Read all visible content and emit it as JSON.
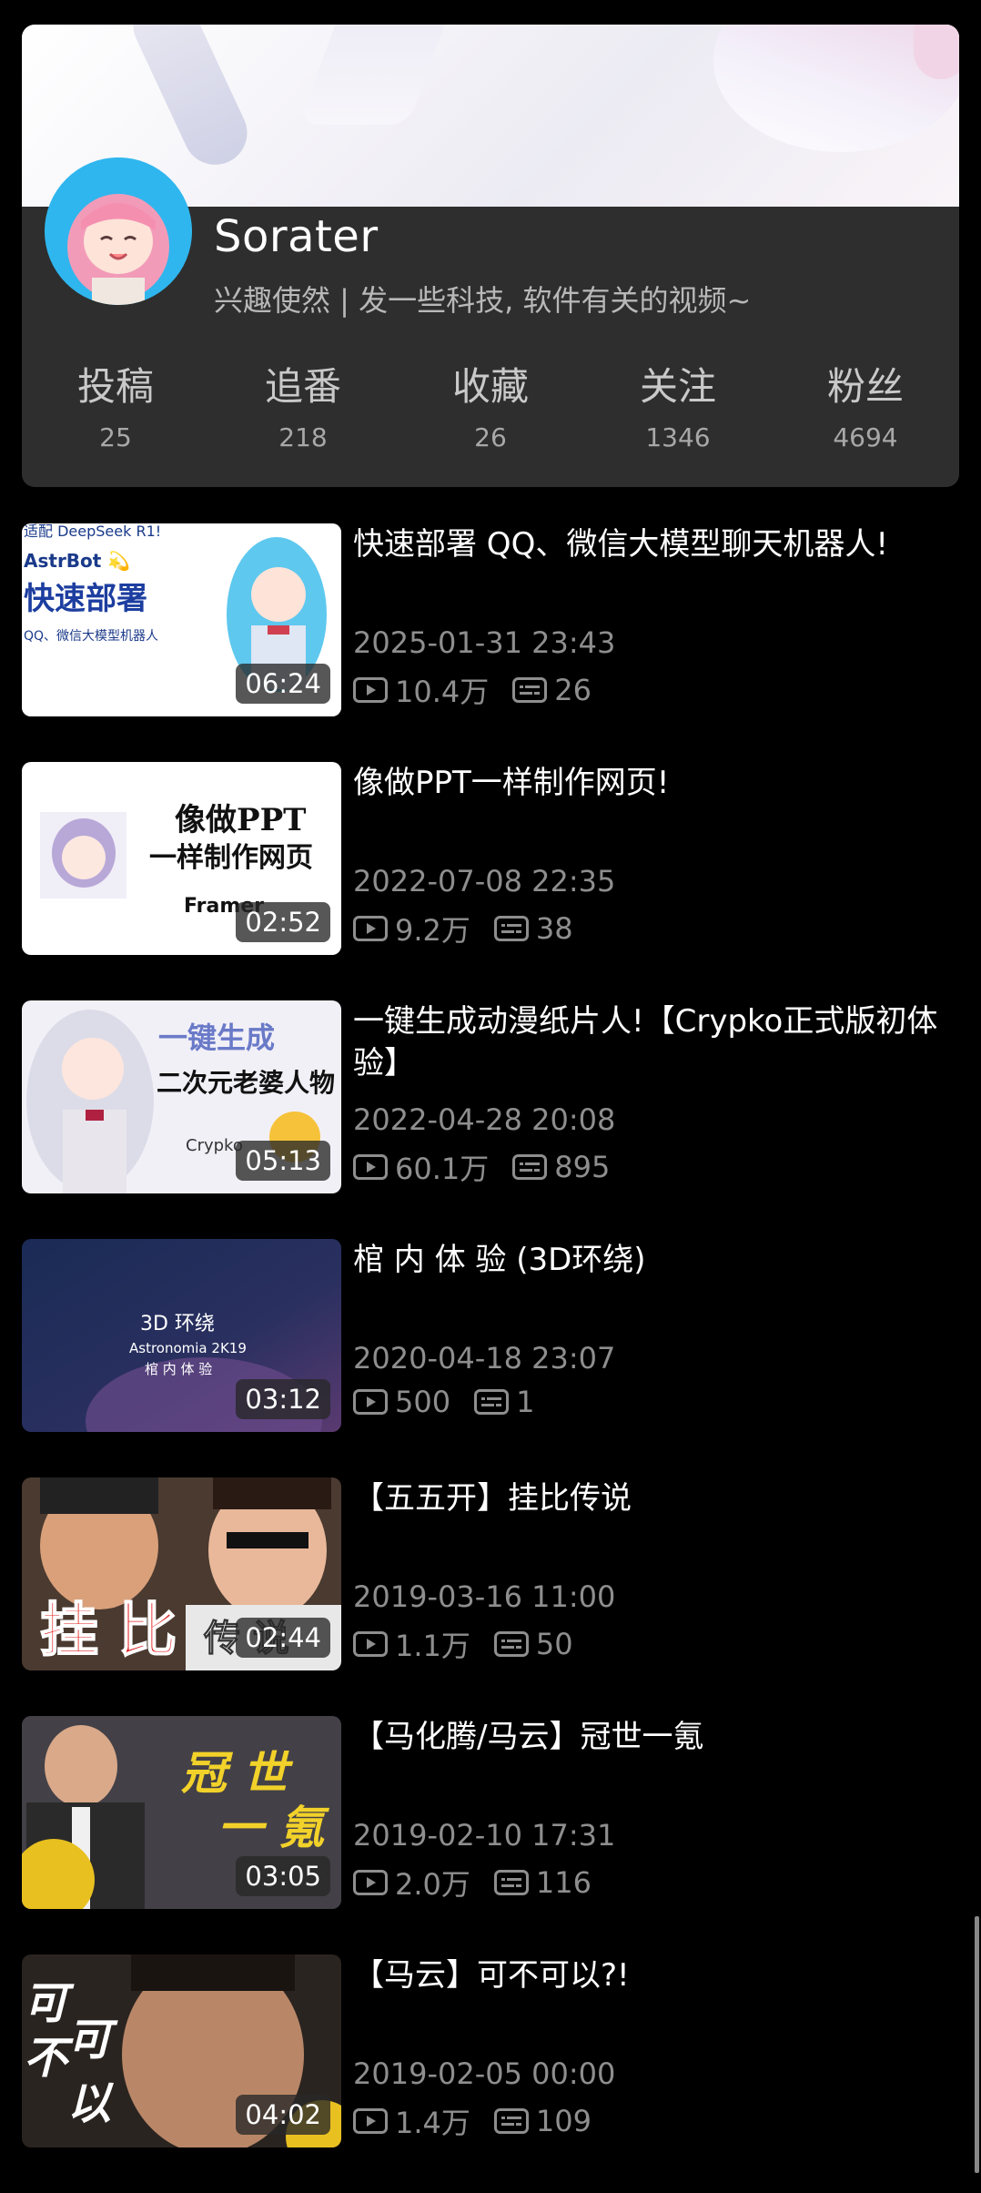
{
  "profile": {
    "name": "Sorater",
    "bio": "兴趣使然 | 发一些科技, 软件有关的视频~",
    "stats": [
      {
        "label": "投稿",
        "value": "25"
      },
      {
        "label": "追番",
        "value": "218"
      },
      {
        "label": "收藏",
        "value": "26"
      },
      {
        "label": "关注",
        "value": "1346"
      },
      {
        "label": "粉丝",
        "value": "4694"
      }
    ]
  },
  "videos": [
    {
      "title": "快速部署 QQ、微信大模型聊天机器人!",
      "date": "2025-01-31 23:43",
      "views": "10.4万",
      "danmaku": "26",
      "duration": "06:24",
      "thumb": {
        "bg": "#ffffff",
        "lines": [
          "适配 DeepSeek R1!",
          "AstrBot 💫",
          "快速部署",
          "QQ、微信大模型机器人"
        ]
      }
    },
    {
      "title": "像做PPT一样制作网页!",
      "date": "2022-07-08 22:35",
      "views": "9.2万",
      "danmaku": "38",
      "duration": "02:52",
      "thumb": {
        "bg": "#ffffff",
        "lines": [
          "像做PPT",
          "一样制作网页",
          "Framer"
        ]
      }
    },
    {
      "title": "一键生成动漫纸片人!【Crypko正式版初体验】",
      "date": "2022-04-28 20:08",
      "views": "60.1万",
      "danmaku": "895",
      "duration": "05:13",
      "thumb": {
        "bg": "#f2f0f7",
        "lines": [
          "一键生成",
          "二次元老婆人物",
          "Crypko"
        ]
      }
    },
    {
      "title": "棺 内 体 验 (3D环绕)",
      "date": "2020-04-18 23:07",
      "views": "500",
      "danmaku": "1",
      "duration": "03:12",
      "thumb": {
        "bg": "#1b2340",
        "lines": [
          "3D 环绕",
          "Astronomia 2K19",
          "棺 内 体 验"
        ]
      }
    },
    {
      "title": "【五五开】挂比传说",
      "date": "2019-03-16 11:00",
      "views": "1.1万",
      "danmaku": "50",
      "duration": "02:44",
      "thumb": {
        "bg": "#4a3a30",
        "lines": [
          "挂 比",
          "传 说"
        ]
      }
    },
    {
      "title": "【马化腾/马云】冠世一氪",
      "date": "2019-02-10 17:31",
      "views": "2.0万",
      "danmaku": "116",
      "duration": "03:05",
      "thumb": {
        "bg": "#3a3a3a",
        "lines": [
          "冠 世",
          "一 氪"
        ]
      }
    },
    {
      "title": "【马云】可不可以?!",
      "date": "2019-02-05 00:00",
      "views": "1.4万",
      "danmaku": "109",
      "duration": "04:02",
      "thumb": {
        "bg": "#2a2420",
        "lines": [
          "可",
          "不",
          "可",
          "以"
        ]
      }
    }
  ],
  "icons": {
    "views": "play-count-icon",
    "danmaku": "danmaku-count-icon"
  }
}
